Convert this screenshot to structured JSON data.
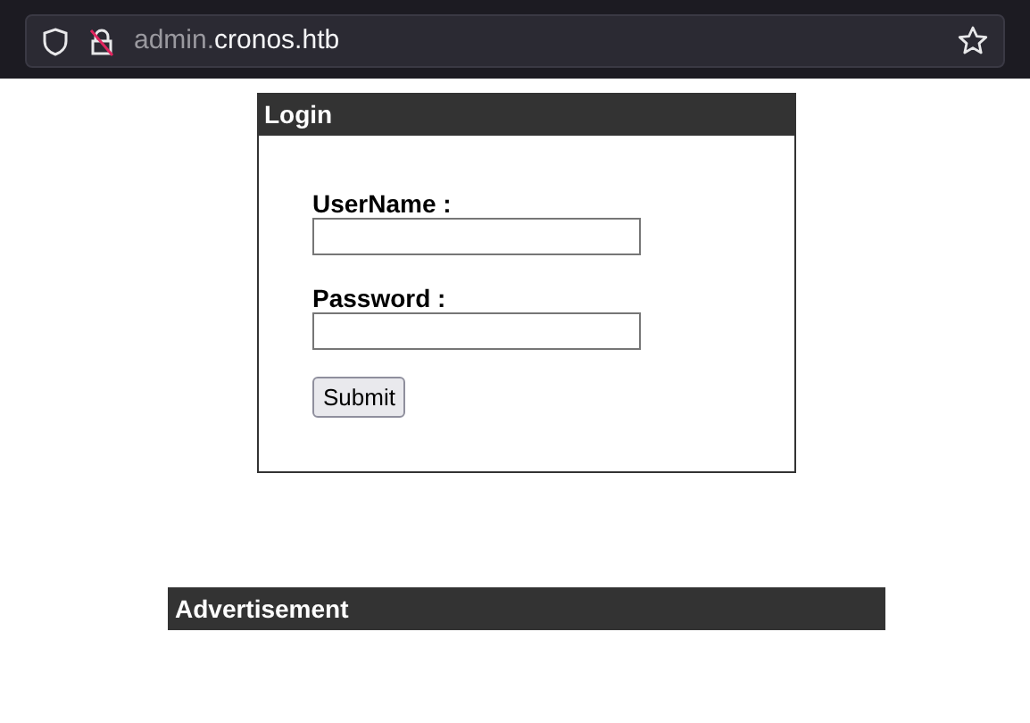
{
  "browser": {
    "url_prefix": "admin.",
    "url_host": "cronos.htb"
  },
  "login": {
    "title": "Login",
    "fields": [
      {
        "label": "UserName :"
      },
      {
        "label": "Password :"
      }
    ],
    "submit": "Submit"
  },
  "advertisement": {
    "title": "Advertisement"
  }
}
